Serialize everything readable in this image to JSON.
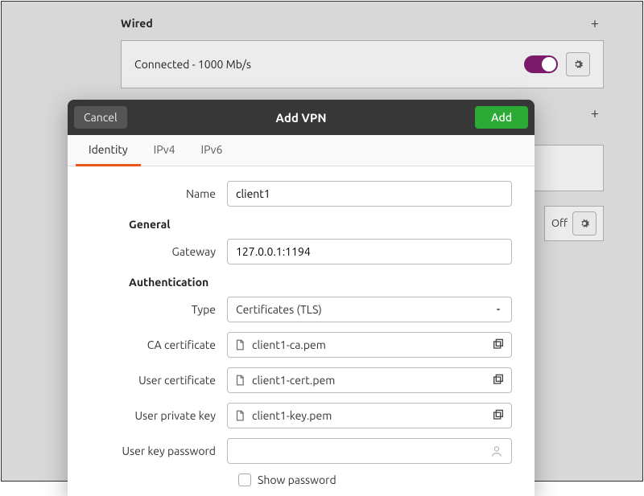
{
  "background": {
    "wired_title": "Wired",
    "wired_status": "Connected - 1000 Mb/s",
    "off_label": "Off"
  },
  "dialog": {
    "cancel": "Cancel",
    "title": "Add VPN",
    "add": "Add",
    "tabs": {
      "identity": "Identity",
      "ipv4": "IPv4",
      "ipv6": "IPv6"
    },
    "name_label": "Name",
    "name_value": "client1",
    "general_heading": "General",
    "gateway_label": "Gateway",
    "gateway_value": "127.0.0.1:1194",
    "auth_heading": "Authentication",
    "type_label": "Type",
    "type_value": "Certificates (TLS)",
    "ca_label": "CA certificate",
    "ca_value": "client1-ca.pem",
    "ucert_label": "User certificate",
    "ucert_value": "client1-cert.pem",
    "ukey_label": "User private key",
    "ukey_value": "client1-key.pem",
    "upwd_label": "User key password",
    "show_pwd": "Show password"
  }
}
